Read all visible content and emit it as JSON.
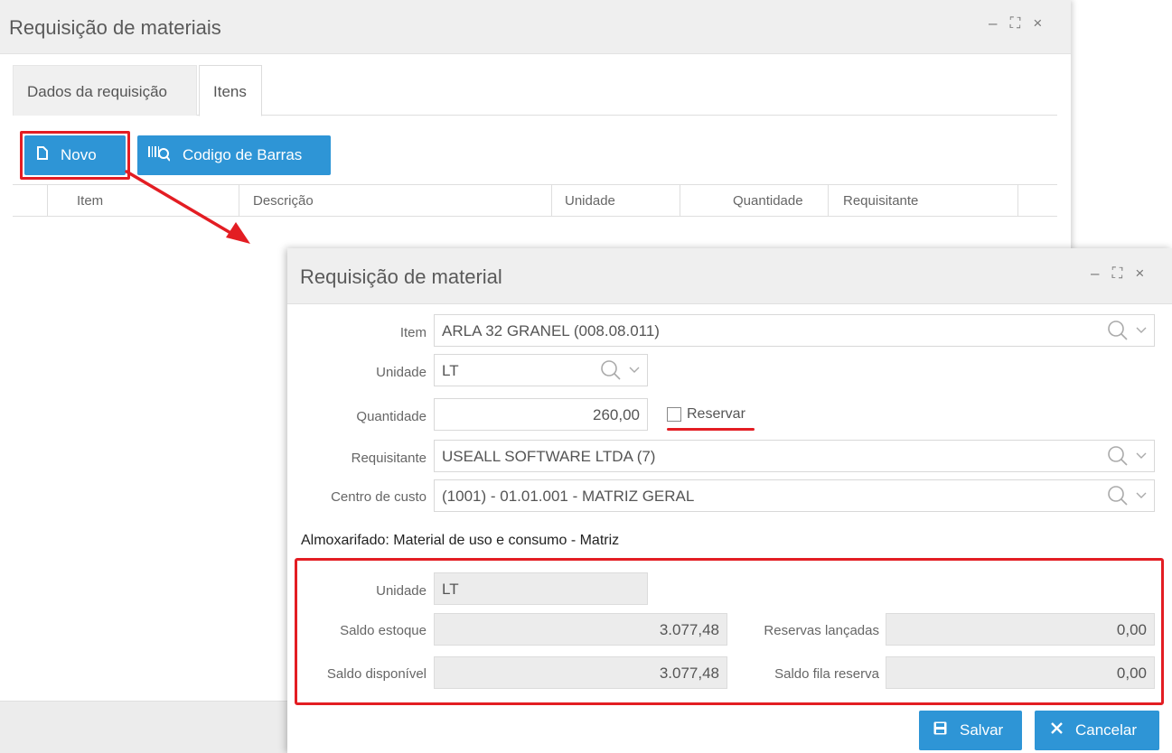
{
  "back_window": {
    "title": "Requisição de materiais",
    "controls": {
      "minimize": "–",
      "maximize": "⛶",
      "close": "×"
    },
    "tabs": [
      {
        "label": "Dados da requisição"
      },
      {
        "label": "Itens"
      }
    ],
    "toolbar": {
      "novo_label": "Novo",
      "barcode_label": "Codigo de Barras"
    },
    "grid_columns": [
      "Item",
      "Descrição",
      "Unidade",
      "Quantidade",
      "Requisitante"
    ]
  },
  "dialog": {
    "title": "Requisição de material",
    "controls": {
      "minimize": "–",
      "maximize": "⛶",
      "close": "×"
    },
    "fields": {
      "item": {
        "label": "Item",
        "value": "ARLA 32 GRANEL (008.08.011)"
      },
      "unidade": {
        "label": "Unidade",
        "value": "LT"
      },
      "quantidade": {
        "label": "Quantidade",
        "value": "260,00"
      },
      "reservar": {
        "label": "Reservar",
        "checked": false
      },
      "requisitante": {
        "label": "Requisitante",
        "value": "USEALL SOFTWARE LTDA (7)"
      },
      "centro_custo": {
        "label": "Centro de custo",
        "value": "(1001) - 01.01.001 - MATRIZ GERAL"
      }
    },
    "almoxarifado": {
      "title": "Almoxarifado: Material de uso e consumo - Matriz",
      "unidade": {
        "label": "Unidade",
        "value": "LT"
      },
      "saldo_estoque": {
        "label": "Saldo estoque",
        "value": "3.077,48"
      },
      "saldo_disponivel": {
        "label": "Saldo disponível",
        "value": "3.077,48"
      },
      "reservas_lancadas": {
        "label": "Reservas lançadas",
        "value": "0,00"
      },
      "saldo_fila_reserva": {
        "label": "Saldo fila reserva",
        "value": "0,00"
      }
    },
    "buttons": {
      "salvar_label": "Salvar",
      "cancelar_label": "Cancelar"
    }
  },
  "colors": {
    "accent_blue": "#2e95d6",
    "highlight_red": "#e31d23"
  }
}
